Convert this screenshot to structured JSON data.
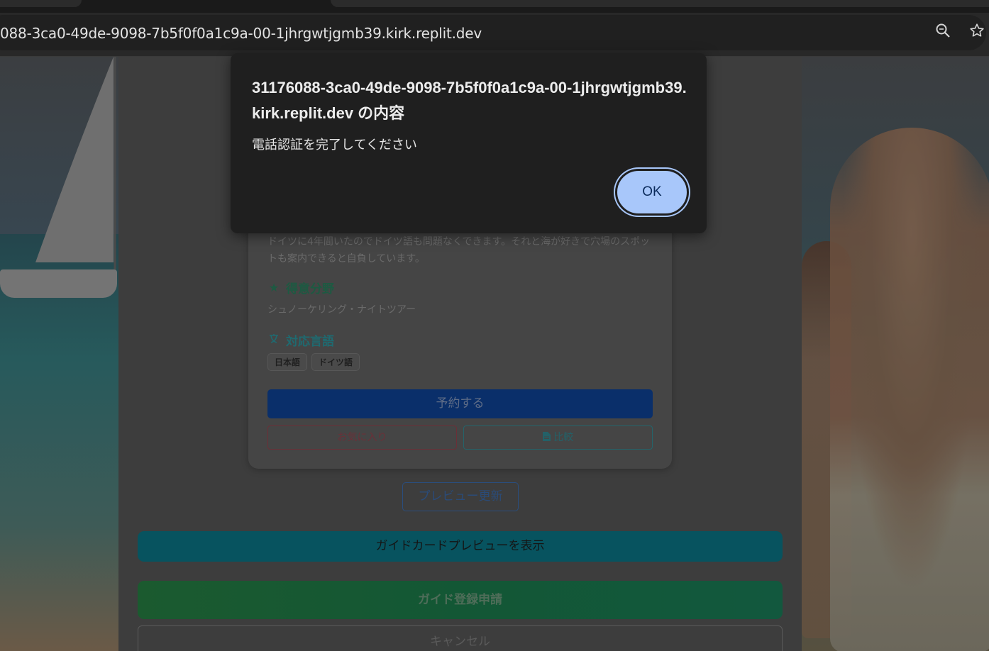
{
  "browser": {
    "url": "088-3ca0-49de-9098-7b5f0f0a1c9a-00-1jhrgwtjgmb39.kirk.replit.dev",
    "zoom_icon": "zoom-icon",
    "bookmark_icon": "star-icon"
  },
  "card": {
    "description": "ドイツに4年間いたのでドイツ語も問題なくできます。それと海が好きで穴場のスポットも案内できると自負しています。",
    "specialty_heading": "得意分野",
    "specialty_value": "シュノーケリング・ナイトツアー",
    "languages_heading": "対応言語",
    "languages": [
      "日本語",
      "ドイツ語"
    ],
    "reserve_label": "予約する",
    "favorite_label": "お気に入り",
    "compare_label": "比較"
  },
  "form": {
    "preview_update_label": "プレビュー更新",
    "show_preview_label": "ガイドカードプレビューを表示",
    "register_label": "ガイド登録申請",
    "cancel_label": "キャンセル"
  },
  "dialog": {
    "title": "31176088-3ca0-49de-9098-7b5f0f0a1c9a-00-1jhrgwtjgmb39.kirk.replit.dev の内容",
    "message": "電話認証を完了してください",
    "ok_label": "OK"
  },
  "colors": {
    "dialog_bg": "#1f1f1f",
    "ok_button": "#a8c7fa"
  }
}
